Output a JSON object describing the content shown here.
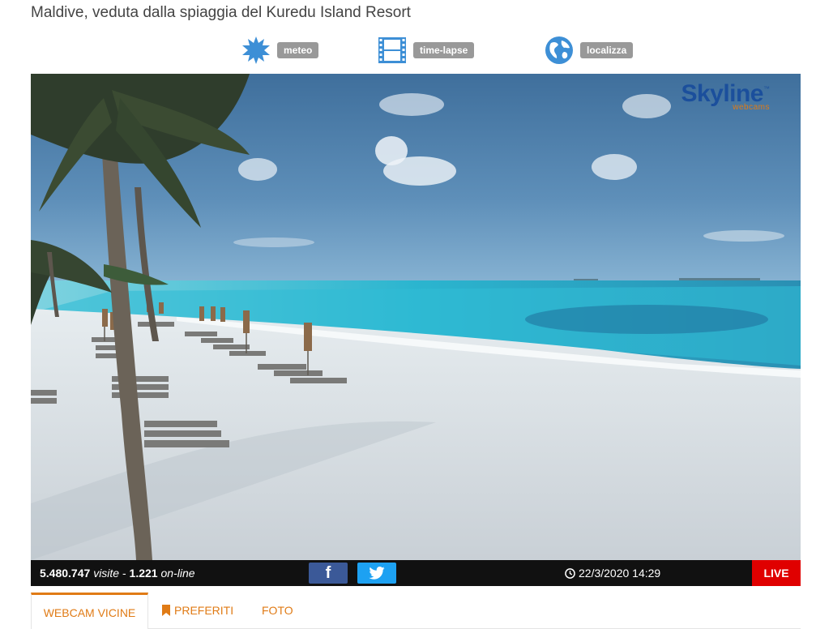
{
  "page_title": "Maldive, veduta dalla spiaggia del Kuredu Island Resort",
  "actions": {
    "meteo": {
      "label": "meteo",
      "icon": "sun-weather-icon"
    },
    "timelapse": {
      "label": "time-lapse",
      "icon": "film-strip-icon"
    },
    "localizza": {
      "label": "localizza",
      "icon": "globe-icon"
    }
  },
  "player": {
    "logo_text": "Skyline",
    "logo_subtext": "webcams",
    "logo_tm": "™"
  },
  "infobar": {
    "visits_value": "5.480.747",
    "visits_label": "visite",
    "separator": "-",
    "online_value": "1.221",
    "online_label": "on-line",
    "facebook_glyph": "f",
    "datetime": "22/3/2020 14:29",
    "live_label": "LIVE"
  },
  "tabs": {
    "vicine": "WEBCAM VICINE",
    "preferiti": "PREFERITI",
    "foto": "FOTO"
  },
  "colors": {
    "accent": "#e07b16",
    "live_red": "#e00000",
    "facebook": "#3b5998",
    "twitter": "#1da1f2",
    "logo_blue": "#1b4f9c"
  }
}
